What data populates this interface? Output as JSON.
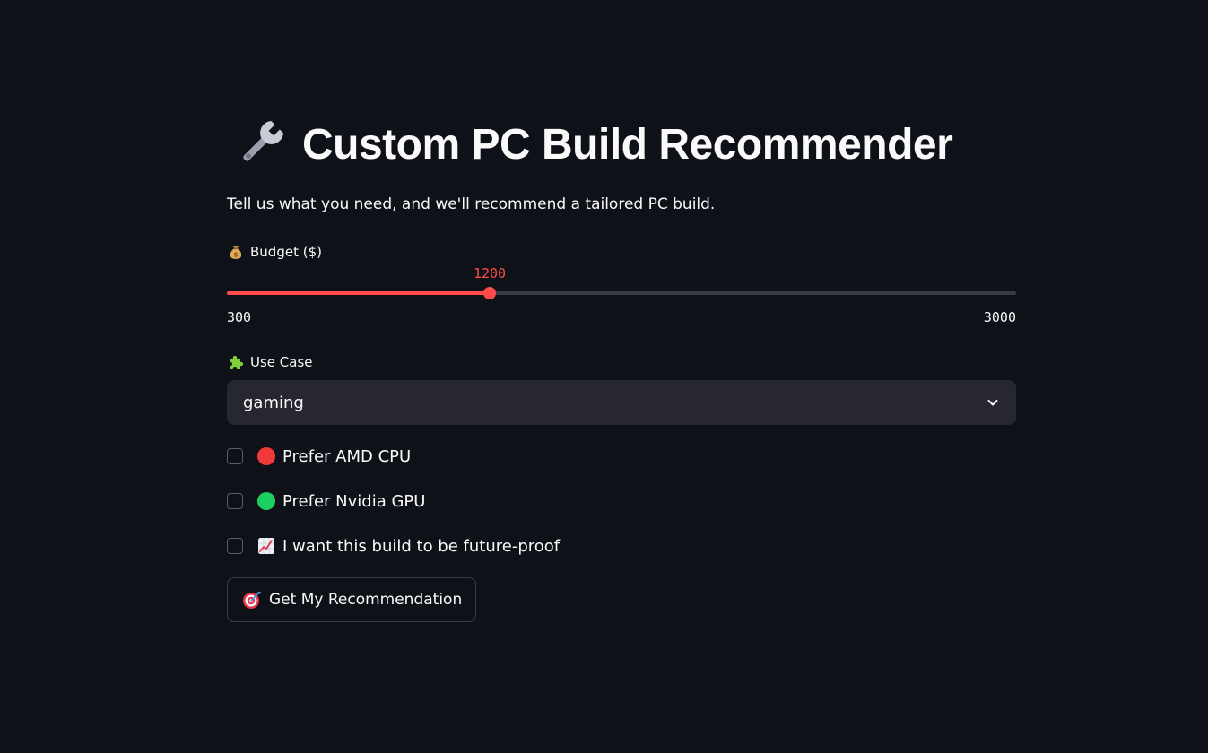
{
  "page": {
    "title": "Custom PC Build Recommender",
    "title_icon": "wrench-icon",
    "subtitle": "Tell us what you need, and we'll recommend a tailored PC build."
  },
  "budget": {
    "label": "Budget ($)",
    "icon": "money-bag-icon",
    "value": 1200,
    "value_text": "1200",
    "min": 300,
    "max": 3000,
    "min_text": "300",
    "max_text": "3000"
  },
  "use_case": {
    "label": "Use Case",
    "icon": "puzzle-piece-icon",
    "selected": "gaming"
  },
  "options": [
    {
      "label": "Prefer AMD CPU",
      "icon": "red-circle-icon",
      "color": "#f23a3a",
      "checked": false
    },
    {
      "label": "Prefer Nvidia GPU",
      "icon": "green-circle-icon",
      "color": "#1ccf63",
      "checked": false
    },
    {
      "label": "I want this build to be future-proof",
      "icon": "chart-increasing-icon",
      "checked": false
    }
  ],
  "submit": {
    "label": "Get My Recommendation",
    "icon": "target-icon"
  },
  "colors": {
    "background": "#0e1117",
    "accent": "#ff4b4b",
    "input_background": "#262730"
  }
}
